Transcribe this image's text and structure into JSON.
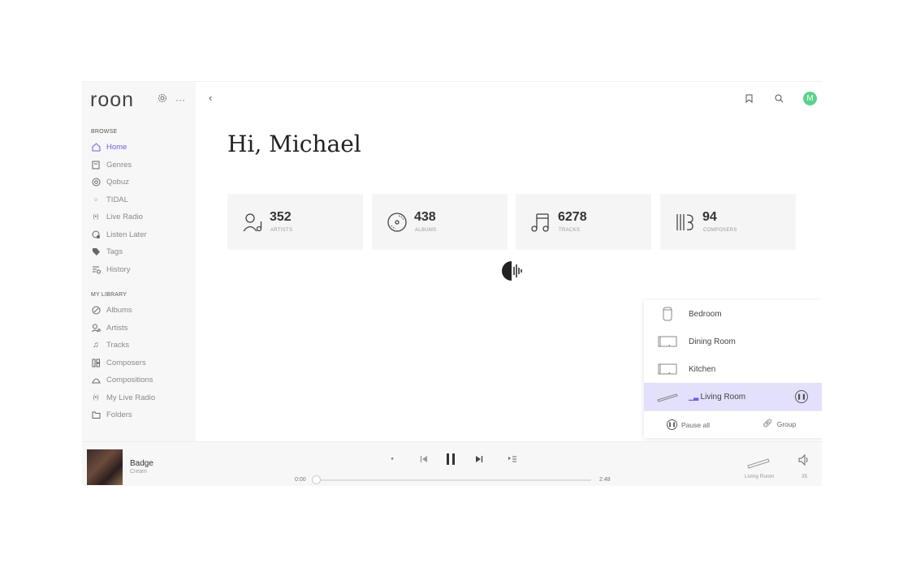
{
  "app": {
    "logo": "roon"
  },
  "sidebar": {
    "browse_label": "BROWSE",
    "browse_items": [
      {
        "label": "Home",
        "icon": "home-icon",
        "active": true
      },
      {
        "label": "Genres",
        "icon": "genres-icon"
      },
      {
        "label": "Qobuz",
        "icon": "qobuz-icon"
      },
      {
        "label": "TIDAL",
        "icon": "tidal-icon"
      },
      {
        "label": "Live Radio",
        "icon": "radio-icon"
      },
      {
        "label": "Listen Later",
        "icon": "listen-later-icon"
      },
      {
        "label": "Tags",
        "icon": "tag-icon"
      },
      {
        "label": "History",
        "icon": "history-icon"
      }
    ],
    "library_label": "MY LIBRARY",
    "library_items": [
      {
        "label": "Albums",
        "icon": "album-icon"
      },
      {
        "label": "Artists",
        "icon": "artist-icon"
      },
      {
        "label": "Tracks",
        "icon": "track-icon"
      },
      {
        "label": "Composers",
        "icon": "composer-icon"
      },
      {
        "label": "Compositions",
        "icon": "composition-icon"
      },
      {
        "label": "My Live Radio",
        "icon": "radio-icon"
      },
      {
        "label": "Folders",
        "icon": "folder-icon"
      }
    ]
  },
  "header": {
    "avatar_initial": "M"
  },
  "main": {
    "greeting": "Hi, Michael",
    "stats": [
      {
        "value": "352",
        "label": "ARTISTS",
        "icon": "artist-icon"
      },
      {
        "value": "438",
        "label": "ALBUMS",
        "icon": "album-icon"
      },
      {
        "value": "6278",
        "label": "TRACKS",
        "icon": "tracks-icon"
      },
      {
        "value": "94",
        "label": "COMPOSERS",
        "icon": "composers-icon"
      }
    ]
  },
  "zones": {
    "items": [
      {
        "name": "Bedroom",
        "icon": "speaker-icon"
      },
      {
        "name": "Dining Room",
        "icon": "tv-icon"
      },
      {
        "name": "Kitchen",
        "icon": "tv-icon"
      },
      {
        "name": "Living Room",
        "icon": "soundbar-icon",
        "active": true
      }
    ],
    "pause_all": "Pause all",
    "group": "Group"
  },
  "player": {
    "title": "Badge",
    "artist": "Cream",
    "elapsed": "0:00",
    "duration": "2:48",
    "progress": 0,
    "zone": "Living Room",
    "volume": "35"
  },
  "colors": {
    "accent": "#6b5cf0",
    "active_zone_bg": "#e2e0fb",
    "avatar": "#5ad38a"
  }
}
